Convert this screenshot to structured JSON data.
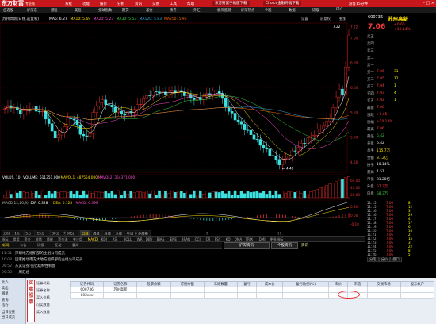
{
  "app": {
    "brand": "东方财富",
    "edition": "专业版",
    "promo1": "东方财富手机版下载",
    "promo2": "Choice金融终端下载",
    "user": "游客15分钟",
    "window_controls": "– □ ×"
  },
  "top_menu": [
    "系统",
    "功能",
    "报价",
    "分析",
    "资讯",
    "交易",
    "工具",
    "帮助"
  ],
  "menu_bar": [
    "自选股",
    "沪深京",
    "港股",
    "美股",
    "全球指数",
    "期货",
    "基金",
    "债券",
    "外汇",
    "板块监测",
    "沪深热点",
    "个股",
    "数据",
    "研报",
    "F10"
  ],
  "chart": {
    "stock_title": "苏州高新(日线,前复权)",
    "ma_legend": [
      {
        "text": "MA5: 6.27",
        "color": "#ffffff"
      },
      {
        "text": "MA10: 5.69",
        "color": "#ffe000"
      },
      {
        "text": "MA20: 5.23",
        "color": "#ff4fd1"
      },
      {
        "text": "MA30: 5.53",
        "color": "#3bd13b"
      },
      {
        "text": "MA120: 5.83",
        "color": "#3ad"
      },
      {
        "text": "MA250: 5.96",
        "color": "#ff6b00"
      }
    ],
    "price_ticks": [
      "7.22",
      "7.00",
      "6.50",
      "6.00",
      "5.50",
      "5.00",
      "4.50"
    ],
    "high_label": "7.22",
    "low_label": "4.40",
    "vol_legend": [
      {
        "text": "VOLUS, 10",
        "color": "#ffffff"
      },
      {
        "text": "VOLUME: 511351.000",
        "color": "#ffffff"
      },
      {
        "text": "MAVOL1: 487554.000",
        "color": "#ffe000"
      },
      {
        "text": "MAVOL2: 364371.000",
        "color": "#ff4fd1"
      }
    ],
    "vol_ticks": [
      "60.00",
      "40.00",
      "20.00"
    ],
    "macd_legend": [
      {
        "text": "MACD(12,26,9)",
        "color": "#bbbbbb"
      },
      {
        "text": "DIF: 0.328",
        "color": "#ffffff"
      },
      {
        "text": "DEA: 0.128",
        "color": "#ffe000"
      },
      {
        "text": "MACD: 0.399",
        "color": "#ff4fd1"
      }
    ],
    "macd_ticks": [
      "0.30",
      "0.00",
      "-0.10"
    ],
    "period_tabs": [
      "分时",
      "1分",
      "5分",
      "15分",
      "30分",
      "60分",
      "日线",
      "周线",
      "月线",
      "季线",
      "年线",
      "多周期"
    ],
    "right_tabs": [
      "设置",
      "前复权",
      "叠加"
    ],
    "month_labels": [
      "7",
      "8",
      "9",
      "10"
    ]
  },
  "index_tabs": [
    "指标",
    "常用",
    "资金",
    "能量",
    "量能",
    "资金流",
    "关注度",
    "MACD",
    "KDJ",
    "RSI",
    "BOLL",
    "WR",
    "DBV",
    "BIAS",
    "ENE",
    "BRAR",
    "CCI",
    "CR",
    "PSY",
    "KD",
    "DMA",
    "TRIX",
    "DMI",
    "更多指标"
  ],
  "news": {
    "tabs": [
      "新闻",
      "公告",
      "研报",
      "互动",
      "要闻"
    ],
    "items": [
      {
        "time": "11:31",
        "text": "深圳地方组织部的主组公司成员"
      },
      {
        "time": "10:08",
        "text": "国家推动南方大地方组织部的主组公司成员"
      },
      {
        "time": "09:52",
        "text": "东吴证券:强化结构性机会"
      },
      {
        "time": "09:30",
        "text": "一周汇总"
      }
    ],
    "button1": "沪深资讯",
    "button2": "个股资讯",
    "ticker_title": "资讯"
  },
  "quote": {
    "code": "600736",
    "name": "苏州高新",
    "price": "7.06",
    "change": "+0.65",
    "pct": "+10.14%",
    "rows": [
      {
        "l": "卖五",
        "v": "",
        "v2": "",
        "cls": "red"
      },
      {
        "l": "卖四",
        "v": "",
        "v2": "",
        "cls": "red"
      },
      {
        "l": "卖三",
        "v": "",
        "v2": "",
        "cls": "red"
      },
      {
        "l": "卖二",
        "v": "",
        "v2": "",
        "cls": "red"
      },
      {
        "l": "卖一",
        "v": "",
        "v2": "",
        "cls": "red"
      },
      {
        "l": "买一",
        "v": "7.06",
        "v2": "31",
        "cls": "red"
      },
      {
        "l": "买二",
        "v": "7.05",
        "v2": "12",
        "cls": "red"
      },
      {
        "l": "买三",
        "v": "7.04",
        "v2": "1",
        "cls": "red"
      },
      {
        "l": "买四",
        "v": "7.03",
        "v2": "4",
        "cls": "red"
      },
      {
        "l": "买五",
        "v": "7.02",
        "v2": "1",
        "cls": "red"
      },
      {
        "l": "最新",
        "v": "7.06",
        "v2": "",
        "cls": "red"
      },
      {
        "l": "涨跌",
        "v": "+0.65",
        "v2": "",
        "cls": "red"
      },
      {
        "l": "涨幅",
        "v": "+10.14%",
        "v2": "",
        "cls": "red"
      },
      {
        "l": "最高",
        "v": "7.06",
        "v2": "",
        "cls": "red"
      },
      {
        "l": "最低",
        "v": "6.42",
        "v2": "",
        "cls": "grn"
      },
      {
        "l": "开盘",
        "v": "6.42",
        "v2": "",
        "cls": "wht"
      },
      {
        "l": "总手",
        "v": "115.7万",
        "v2": "",
        "cls": "yel"
      },
      {
        "l": "金额",
        "v": "8.12亿",
        "v2": "",
        "cls": "yel"
      },
      {
        "l": "换手",
        "v": "10.14%",
        "v2": "",
        "cls": "wht"
      },
      {
        "l": "量比",
        "v": "1.51",
        "v2": "",
        "cls": "wht"
      },
      {
        "l": "市值",
        "v": "81.28亿",
        "v2": "",
        "cls": "wht"
      },
      {
        "l": "外盘",
        "v": "57.3万",
        "v2": "",
        "cls": "red"
      },
      {
        "l": "内盘",
        "v": "58.3万",
        "v2": "",
        "cls": "grn"
      }
    ],
    "ticks": [
      {
        "t": "11:15",
        "p": "7.06",
        "v": "8"
      },
      {
        "t": "11:15",
        "p": "7.06",
        "v": "12"
      },
      {
        "t": "11:16",
        "p": "7.06",
        "v": "3"
      },
      {
        "t": "11:16",
        "p": "7.06",
        "v": "29"
      },
      {
        "t": "11:17",
        "p": "7.06",
        "v": "4"
      },
      {
        "t": "11:18",
        "p": "7.06",
        "v": "17"
      },
      {
        "t": "11:19",
        "p": "7.06",
        "v": "6"
      },
      {
        "t": "11:20",
        "p": "7.06",
        "v": "10"
      },
      {
        "t": "11:21",
        "p": "7.06",
        "v": "2"
      },
      {
        "t": "11:22",
        "p": "7.06",
        "v": "15"
      },
      {
        "t": "11:23",
        "p": "7.06",
        "v": "3"
      },
      {
        "t": "11:24",
        "p": "7.06",
        "v": "22"
      },
      {
        "t": "11:25",
        "p": "7.06",
        "v": "8"
      },
      {
        "t": "11:26",
        "p": "7.06",
        "v": "5"
      }
    ],
    "bottom_tabs": [
      "分笔",
      "分价",
      "盘口"
    ]
  },
  "trade": {
    "side_nav": [
      "买入",
      "卖出",
      "撤单",
      "查询",
      "持仓",
      "当日委托",
      "当日成交"
    ],
    "big_button": "买卖股票",
    "ops": [
      "证券代码",
      "证券名称",
      "买入价格",
      "可买数量",
      "买入数量"
    ],
    "table_headers": [
      "证券代码",
      "证券名称",
      "股票余额",
      "可用余额",
      "冻结数量",
      "盈亏",
      "成本价",
      "盈亏比例(%)",
      "市价",
      "市值",
      "交易市场",
      "股东帐户"
    ],
    "rows": [
      [
        "600736",
        "苏州高新",
        "",
        "",
        "",
        "",
        "",
        "",
        "",
        "",
        "",
        ""
      ],
      [
        "002xxx",
        "",
        "",
        "",
        "",
        "",
        "",
        "",
        "",
        "",
        "",
        ""
      ]
    ]
  }
}
